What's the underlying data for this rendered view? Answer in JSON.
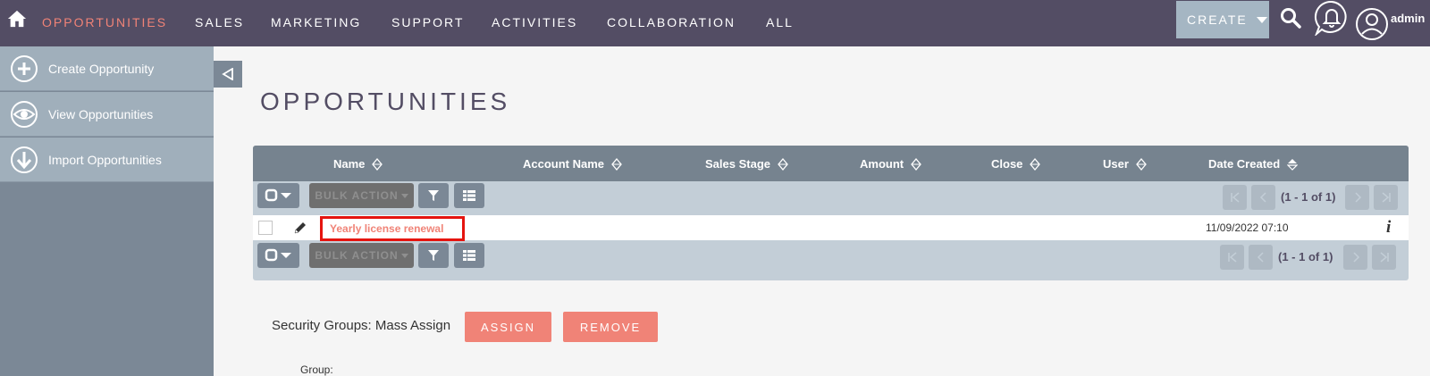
{
  "nav": {
    "items": [
      "OPPORTUNITIES",
      "SALES",
      "MARKETING",
      "SUPPORT",
      "ACTIVITIES",
      "COLLABORATION",
      "ALL"
    ],
    "active_item": "OPPORTUNITIES",
    "create_label": "CREATE",
    "user_label": "admin"
  },
  "sidebar": {
    "items": [
      {
        "label": "Create Opportunity",
        "icon": "plus-circle-icon"
      },
      {
        "label": "View Opportunities",
        "icon": "eye-icon"
      },
      {
        "label": "Import Opportunities",
        "icon": "download-arrow-icon"
      }
    ]
  },
  "page": {
    "title": "OPPORTUNITIES"
  },
  "list": {
    "columns": [
      "Name",
      "Account Name",
      "Sales Stage",
      "Amount",
      "Close",
      "User",
      "Date Created"
    ],
    "bulk_action_label": "BULK ACTION",
    "pagination_text": "(1 - 1 of 1)",
    "rows": [
      {
        "name": "Yearly license renewal",
        "account_name": "",
        "sales_stage": "",
        "amount": "",
        "close": "",
        "user": "",
        "date_created": "11/09/2022 07:10"
      }
    ]
  },
  "security_groups": {
    "label": "Security Groups: Mass Assign",
    "assign_label": "ASSIGN",
    "remove_label": "REMOVE",
    "group_label": "Group:"
  },
  "colors": {
    "nav_bg": "#534d64",
    "accent": "#f08377",
    "highlight_border": "#e5140f"
  }
}
